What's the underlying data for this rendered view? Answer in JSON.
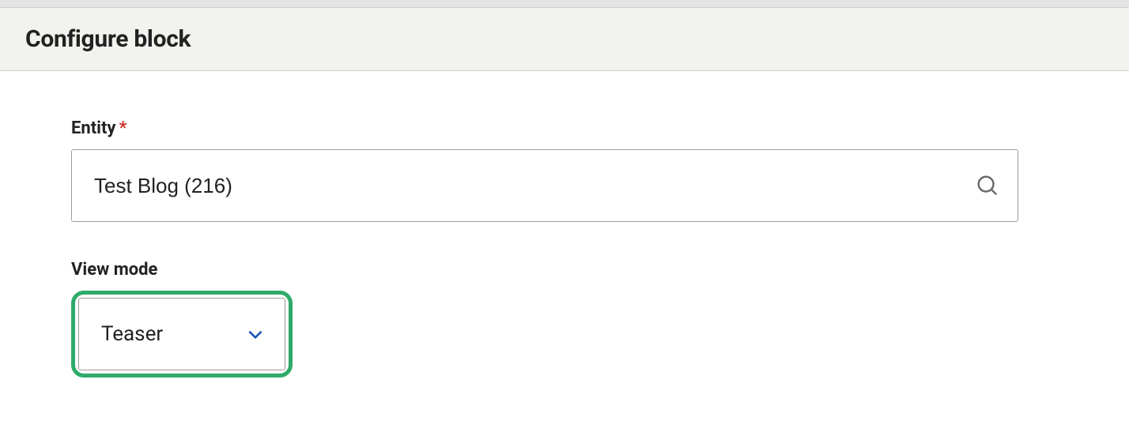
{
  "header": {
    "title": "Configure block"
  },
  "form": {
    "entity": {
      "label": "Entity",
      "required_mark": "*",
      "value": "Test Blog (216)"
    },
    "view_mode": {
      "label": "View mode",
      "selected": "Teaser"
    }
  }
}
